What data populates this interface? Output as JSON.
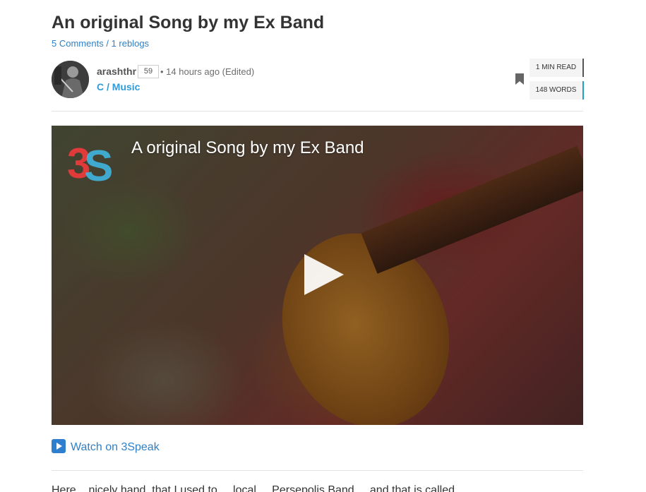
{
  "post": {
    "title": "An original Song by my Ex Band",
    "comments_link": "5 Comments",
    "separator": "/",
    "reblogs_link": "1 reblogs"
  },
  "author": {
    "name": "arashthr",
    "reputation": "59",
    "meta": "• 14 hours ago (Edited)",
    "community": "C / Music"
  },
  "reading": {
    "min_read": "1 MIN READ",
    "words": "148 WORDS"
  },
  "video": {
    "title": "A original Song by my Ex Band",
    "logo": "3S"
  },
  "watch": {
    "label": "Watch on 3Speak"
  },
  "body": {
    "first_line": "Here ...nicely hand, that I used to ... local ... Persepolis Band ... and that is called ..."
  },
  "colors": {
    "link": "#2f80c7",
    "community": "#2f9bd8",
    "accent_teal": "#1aa3c7"
  },
  "icons": [
    "bookmark-icon",
    "play-icon",
    "play-button-emoji-icon",
    "3speak-logo"
  ]
}
